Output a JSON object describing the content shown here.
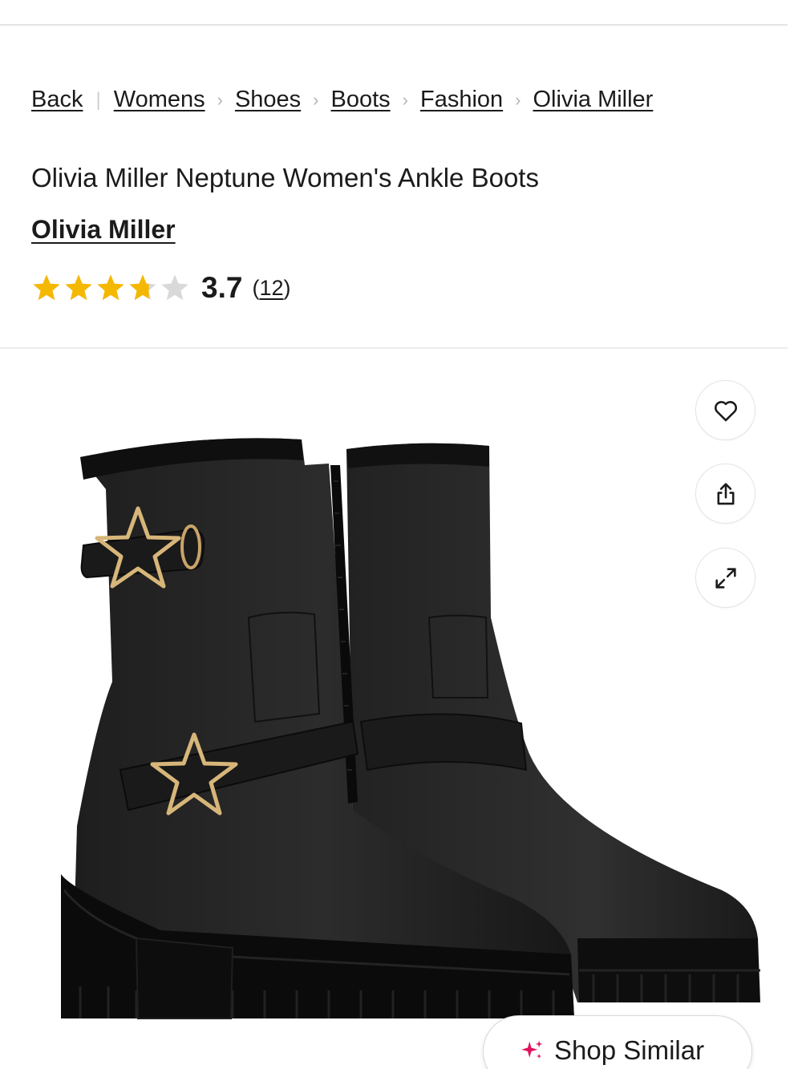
{
  "breadcrumb": {
    "back": "Back",
    "items": [
      "Womens",
      "Shoes",
      "Boots",
      "Fashion",
      "Olivia Miller"
    ]
  },
  "product": {
    "title": "Olivia Miller Neptune Women's Ankle Boots",
    "brand": "Olivia Miller",
    "rating": "3.7",
    "rating_value": 3.7,
    "rating_max": 5,
    "review_count_open": "(",
    "review_count": "12",
    "review_count_close": ")"
  },
  "actions": {
    "favorite_icon": "heart-icon",
    "share_icon": "share-icon",
    "expand_icon": "expand-icon"
  },
  "shop_similar": {
    "label": "Shop Similar",
    "icon": "sparkle-icon"
  },
  "colors": {
    "star_filled": "#f5b800",
    "star_empty": "#d9d9d9",
    "sparkle": "#e0115f",
    "text": "#1b1b1b"
  }
}
